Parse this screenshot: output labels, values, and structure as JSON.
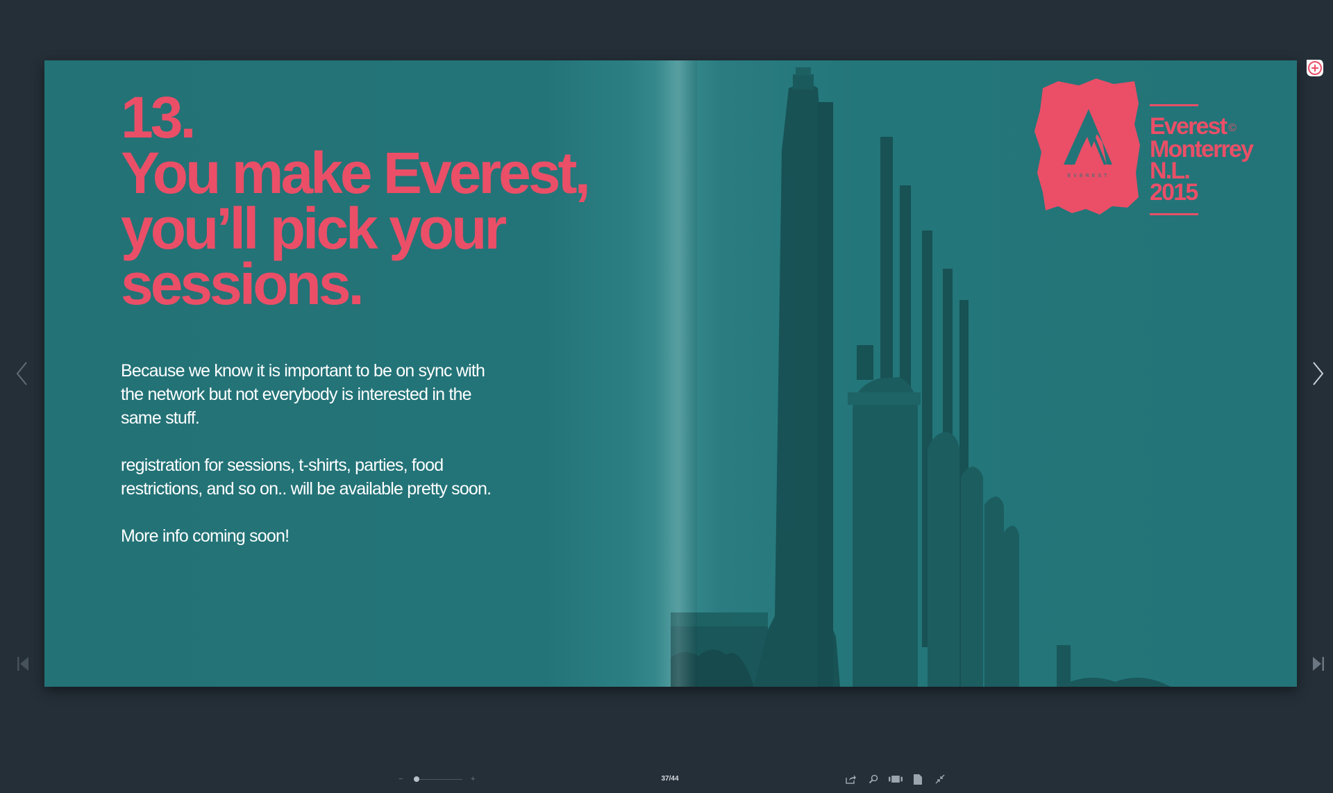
{
  "spread": {
    "headline": {
      "number": "13.",
      "line1": "You make Everest,",
      "line2": "you’ll pick your",
      "line3": "sessions."
    },
    "body": {
      "paragraph1": "Because we know it is important to be on sync with the network but not everybody is interested in the same stuff.",
      "paragraph2": "registration for sessions, t-shirts, parties, food restrictions, and so on.. will be available pretty soon.",
      "paragraph3": "More info coming soon!"
    },
    "logo": {
      "mark_text": "EVEREST",
      "line1": "Everest",
      "copyright": "©",
      "line2": "Monterrey",
      "line3": "N.L.",
      "line4": "2015"
    }
  },
  "navigation": {
    "prev_icon": "chevron-left-icon",
    "next_icon": "chevron-right-icon",
    "first_icon": "skip-first-icon",
    "last_icon": "skip-last-icon",
    "corner_icon": "plus-circle-icon"
  },
  "toolbar": {
    "zoom_minus": "−",
    "zoom_plus": "+",
    "zoom_level": 0.05,
    "page_counter": "37/44",
    "tools": [
      "share-icon",
      "search-icon",
      "thumbnails-icon",
      "page-icon",
      "fullscreen-exit-icon"
    ]
  },
  "colors": {
    "background": "#252f38",
    "page": "#237478",
    "accent": "#ea4f67",
    "text": "#ffffff"
  }
}
